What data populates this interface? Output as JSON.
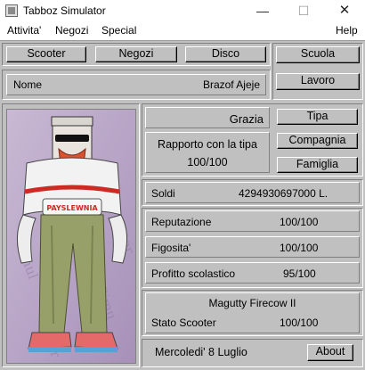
{
  "window": {
    "title": "Tabboz Simulator"
  },
  "menu": {
    "items": [
      "Attivita'",
      "Negozi",
      "Special",
      "Help"
    ]
  },
  "nav": {
    "scooter": "Scooter",
    "negozi": "Negozi",
    "disco": "Disco",
    "scuola": "Scuola",
    "lavoro": "Lavoro"
  },
  "character": {
    "name_label": "Nome",
    "name": "Brazof Ajeje",
    "portrait_icon": "tabboz-character-portrait"
  },
  "tipa": {
    "name": "Grazia",
    "rapporto_label": "Rapporto con la tipa",
    "rapporto_value": "100/100",
    "tipa_button": "Tipa",
    "compagnia_button": "Compagnia",
    "famiglia_button": "Famiglia"
  },
  "stats": {
    "soldi_label": "Soldi",
    "soldi_value": "4294930697000 L.",
    "reputazione_label": "Reputazione",
    "reputazione_value": "100/100",
    "figosita_label": "Figosita'",
    "figosita_value": "100/100",
    "profitto_label": "Profitto scolastico",
    "profitto_value": "95/100"
  },
  "scooter": {
    "model": "Magutty Firecow II",
    "stato_label": "Stato Scooter",
    "stato_value": "100/100"
  },
  "footer": {
    "date": "Mercoledi' 8 Luglio",
    "about_button": "About"
  },
  "colors": {
    "face": "#c0c0c0",
    "portrait_bg": "#b9a6c6",
    "jacket": "#f2f2f2",
    "pants": "#98a06a",
    "accent_red": "#cc2a22"
  }
}
